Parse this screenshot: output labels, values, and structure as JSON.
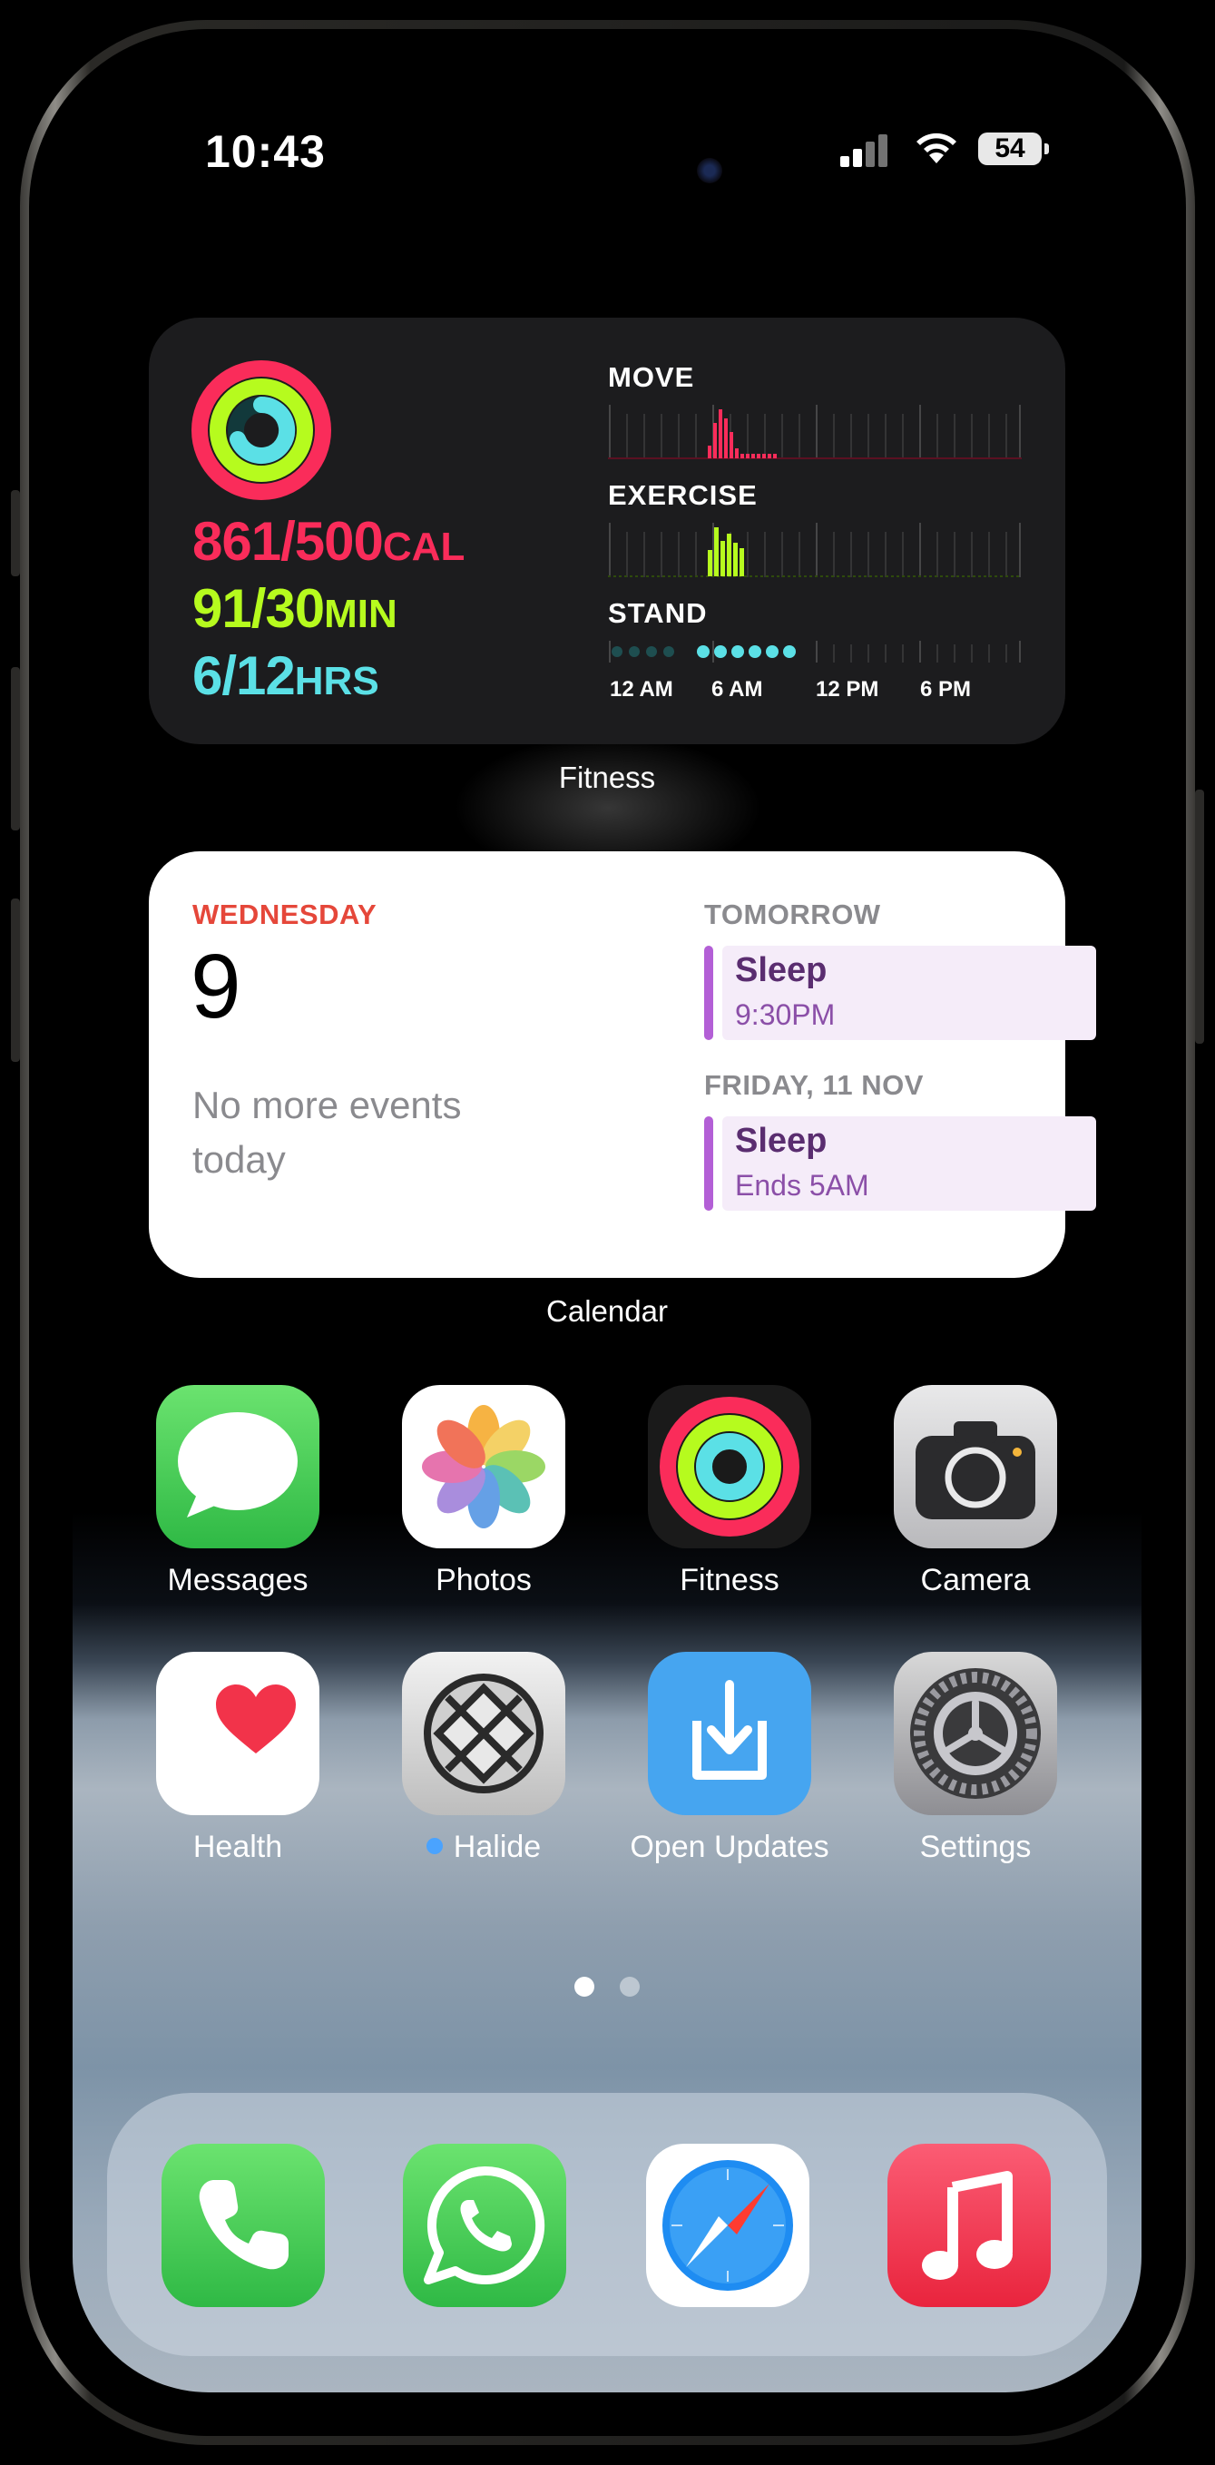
{
  "status_bar": {
    "time": "10:43",
    "battery": "54"
  },
  "fitness_widget": {
    "move": {
      "value": "861/500",
      "unit": "CAL"
    },
    "exercise": {
      "value": "91/30",
      "unit": "MIN"
    },
    "stand": {
      "value": "6/12",
      "unit": "HRS"
    },
    "charts": {
      "move_title": "MOVE",
      "exercise_title": "EXERCISE",
      "stand_title": "STAND"
    },
    "time_labels": [
      "12 AM",
      "6 AM",
      "12 PM",
      "6 PM"
    ],
    "caption": "Fitness",
    "colors": {
      "move": "#fa2c5a",
      "exercise": "#b6fb1e",
      "stand": "#5be0e6"
    }
  },
  "calendar_widget": {
    "weekday": "WEDNESDAY",
    "date": "9",
    "no_events": "No more events today",
    "tomorrow_header": "TOMORROW",
    "friday_header": "FRIDAY, 11 NOV",
    "events": [
      {
        "title": "Sleep",
        "subtitle": "9:30PM"
      },
      {
        "title": "Sleep",
        "subtitle": "Ends 5AM"
      }
    ],
    "caption": "Calendar"
  },
  "apps": [
    {
      "label": "Messages",
      "icon": "messages-icon"
    },
    {
      "label": "Photos",
      "icon": "photos-icon"
    },
    {
      "label": "Fitness",
      "icon": "fitness-icon"
    },
    {
      "label": "Camera",
      "icon": "camera-icon"
    },
    {
      "label": "Health",
      "icon": "health-icon"
    },
    {
      "label": "Halide",
      "icon": "halide-icon"
    },
    {
      "label": "Open Updates",
      "icon": "open-updates-icon"
    },
    {
      "label": "Settings",
      "icon": "settings-icon"
    }
  ],
  "dock": [
    {
      "icon": "phone-icon"
    },
    {
      "icon": "whatsapp-icon"
    },
    {
      "icon": "safari-icon"
    },
    {
      "icon": "music-icon"
    }
  ],
  "page_indicator": {
    "pages": 2,
    "current": 1
  }
}
